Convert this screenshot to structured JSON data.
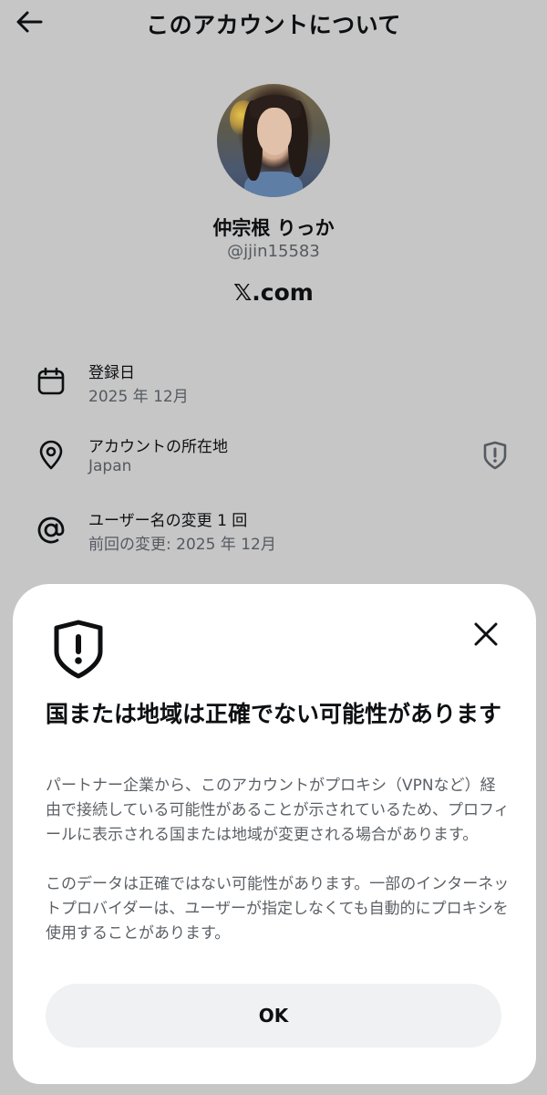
{
  "header": {
    "title": "このアカウントについて",
    "back_icon": "arrow-left-icon"
  },
  "profile": {
    "name": "仲宗根 りっか",
    "handle": "@jjin15583",
    "site": "𝕏.com"
  },
  "info": {
    "rows": [
      {
        "icon": "calendar-icon",
        "label": "登録日",
        "value": "2025 年 12月"
      },
      {
        "icon": "location-pin-icon",
        "label": "アカウントの所在地",
        "value": "Japan"
      },
      {
        "icon": "at-sign-icon",
        "label": "ユーザー名の変更 1 回",
        "value": "前回の変更: 2025 年 12月"
      }
    ]
  },
  "sheet": {
    "icon": "shield-alert-icon",
    "close_icon": "close-icon",
    "title": "国または地域は正確でない可能性があります",
    "paragraph1": "パートナー企業から、このアカウントがプロキシ（VPNなど）経由で接続している可能性があることが示されているため、プロフィールに表示される国または地域が変更される場合があります。",
    "paragraph2": "このデータは正確ではない可能性があります。一部のインターネットプロバイダーは、ユーザーが指定しなくても自動的にプロキシを使用することがあります。",
    "ok_label": "OK"
  },
  "colors": {
    "overlay_background": "#c6c6c6",
    "text_primary": "#0d0f11",
    "text_secondary": "#555a60",
    "button_background": "#eff1f3",
    "sheet_background": "#ffffff"
  }
}
